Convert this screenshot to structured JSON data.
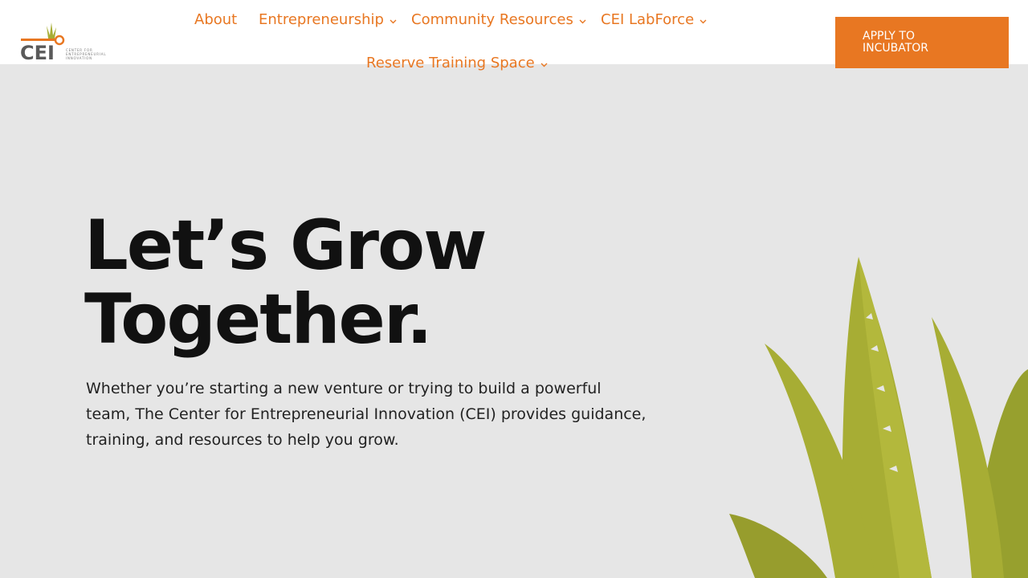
{
  "brand": {
    "logo_text": "CEI",
    "logo_subtext": "CENTER FOR\nENTREPRENEURIAL\nINNOVATION",
    "accent_color": "#e87722",
    "plant_color": "#a7ad34"
  },
  "nav": {
    "items": [
      {
        "label": "About",
        "has_dropdown": false
      },
      {
        "label": "Entrepreneurship",
        "has_dropdown": true
      },
      {
        "label": "Community Resources",
        "has_dropdown": true
      },
      {
        "label": "CEI LabForce",
        "has_dropdown": true
      },
      {
        "label": "Reserve Training Space",
        "has_dropdown": true
      }
    ],
    "cta_label": "APPLY TO\nINCUBATOR"
  },
  "hero": {
    "title": "Let’s Grow Together.",
    "text": "Whether you’re starting a new venture or trying to build a powerful team, The Center for Entrepreneurial Innovation (CEI) provides guidance, training, and resources to help you grow."
  },
  "icons": [
    "chevron-down-icon",
    "plant-illustration"
  ]
}
